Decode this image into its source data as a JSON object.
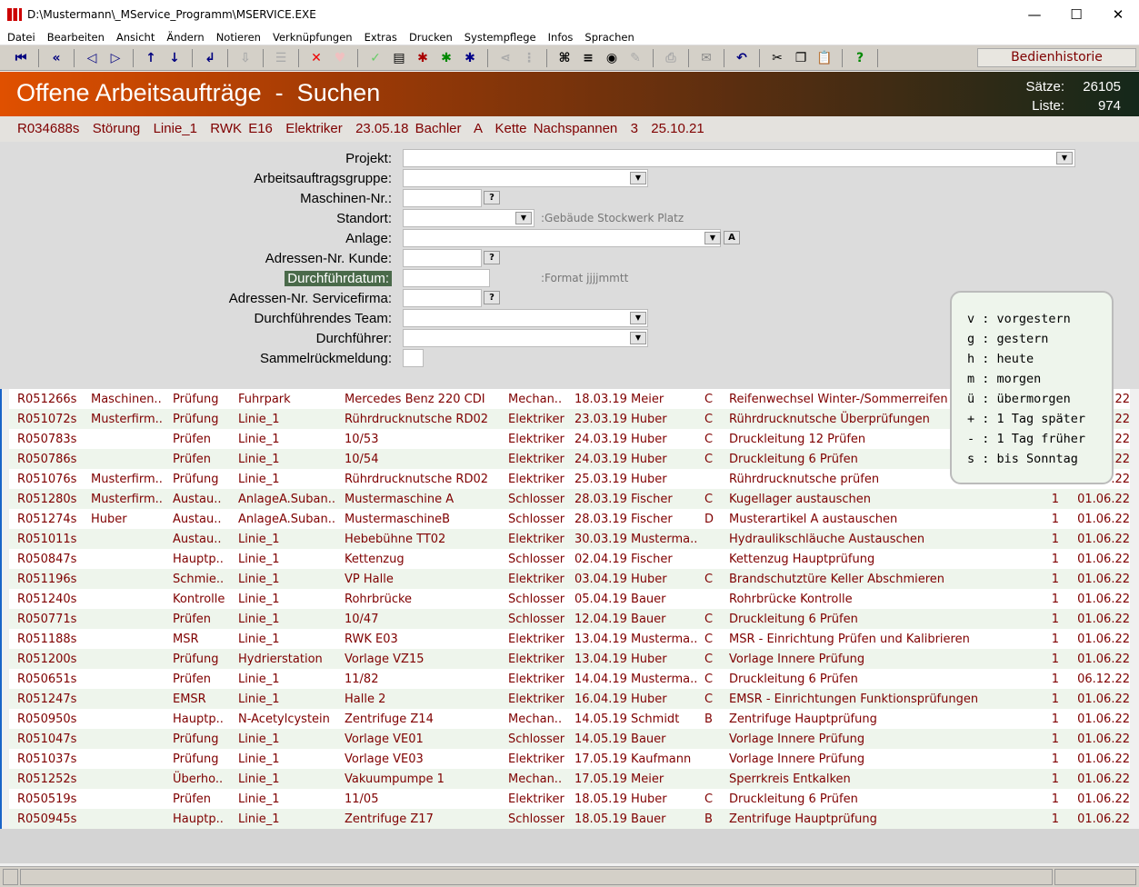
{
  "window": {
    "title": "D:\\Mustermann\\_MService_Programm\\MSERVICE.EXE",
    "min": "—",
    "max": "☐",
    "close": "✕"
  },
  "menu": [
    "Datei",
    "Bearbeiten",
    "Ansicht",
    "Ändern",
    "Notieren",
    "Verknüpfungen",
    "Extras",
    "Drucken",
    "Systempflege",
    "Infos",
    "Sprachen"
  ],
  "toolbar": {
    "history_label": "Bedienhistorie"
  },
  "header": {
    "title": "Offene Arbeitsaufträge  -  Suchen",
    "saetze_label": "Sätze:",
    "saetze": "26105",
    "liste_label": "Liste:",
    "liste": "974"
  },
  "info_line": "R034688s  Störung  Linie_1  RWK E16  Elektriker  23.05.18 Bachler  A  Kette Nachspannen  3  25.10.21",
  "form": {
    "projekt": "Projekt:",
    "gruppe": "Arbeitsauftragsgruppe:",
    "maschine": "Maschinen-Nr.:",
    "standort": "Standort:",
    "standort_hint": ":Gebäude Stockwerk Platz",
    "anlage": "Anlage:",
    "anlage_btn": "A",
    "kunde": "Adressen-Nr. Kunde:",
    "datum": "Durchführdatum:",
    "datum_hint": ":Format jjjjmmtt",
    "servicefirma": "Adressen-Nr. Servicefirma:",
    "team": "Durchführendes Team:",
    "durchfuehrer": "Durchführer:",
    "sammel": "Sammelrückmeldung:",
    "q": "?",
    "dd": "▼"
  },
  "date_help": [
    "v : vorgestern",
    "g : gestern",
    "h : heute",
    "m : morgen",
    "ü : übermorgen",
    "+ : 1 Tag später",
    "- : 1 Tag früher",
    "s : bis Sonntag"
  ],
  "rows": [
    [
      "R051266s",
      "Maschinen..",
      "Prüfung",
      "Fuhrpark",
      "Mercedes Benz 220 CDI",
      "Mechan..",
      "18.03.19 Meier",
      "C",
      "Reifenwechsel Winter-/Sommerreifen",
      "1",
      "01.06.22"
    ],
    [
      "R051072s",
      "Musterfirm..",
      "Prüfung",
      "Linie_1",
      "Rührdrucknutsche RD02",
      "Elektriker",
      "23.03.19 Huber",
      "C",
      "Rührdrucknutsche Überprüfungen",
      "1",
      "01.06.22"
    ],
    [
      "R050783s",
      "",
      "Prüfen",
      "Linie_1",
      "10/53",
      "Elektriker",
      "24.03.19 Huber",
      "C",
      "Druckleitung 12 Prüfen",
      "1",
      "01.06.22"
    ],
    [
      "R050786s",
      "",
      "Prüfen",
      "Linie_1",
      "10/54",
      "Elektriker",
      "24.03.19 Huber",
      "C",
      "Druckleitung 6 Prüfen",
      "1",
      "01.06.22"
    ],
    [
      "R051076s",
      "Musterfirm..",
      "Prüfung",
      "Linie_1",
      "Rührdrucknutsche RD02",
      "Elektriker",
      "25.03.19 Huber",
      "",
      "Rührdrucknutsche prüfen",
      "1",
      "01.06.22"
    ],
    [
      "R051280s",
      "Musterfirm..",
      "Austau..",
      "AnlageA.Suban..",
      "Mustermaschine A",
      "Schlosser",
      "28.03.19 Fischer",
      "C",
      "Kugellager austauschen",
      "1",
      "01.06.22"
    ],
    [
      "R051274s",
      "Huber",
      "Austau..",
      "AnlageA.Suban..",
      "MustermaschineB",
      "Schlosser",
      "28.03.19 Fischer",
      "D",
      "Musterartikel A austauschen",
      "1",
      "01.06.22"
    ],
    [
      "R051011s",
      "",
      "Austau..",
      "Linie_1",
      "Hebebühne TT02",
      "Elektriker",
      "30.03.19 Musterma..",
      "",
      "Hydraulikschläuche Austauschen",
      "1",
      "01.06.22"
    ],
    [
      "R050847s",
      "",
      "Hauptp..",
      "Linie_1",
      "Kettenzug",
      "Schlosser",
      "02.04.19 Fischer",
      "",
      "Kettenzug Hauptprüfung",
      "1",
      "01.06.22"
    ],
    [
      "R051196s",
      "",
      "Schmie..",
      "Linie_1",
      "VP Halle",
      "Elektriker",
      "03.04.19 Huber",
      "C",
      "Brandschutztüre Keller Abschmieren",
      "1",
      "01.06.22"
    ],
    [
      "R051240s",
      "",
      "Kontrolle",
      "Linie_1",
      "Rohrbrücke",
      "Schlosser",
      "05.04.19 Bauer",
      "",
      "Rohrbrücke Kontrolle",
      "1",
      "01.06.22"
    ],
    [
      "R050771s",
      "",
      "Prüfen",
      "Linie_1",
      "10/47",
      "Schlosser",
      "12.04.19 Bauer",
      "C",
      "Druckleitung 6 Prüfen",
      "1",
      "01.06.22"
    ],
    [
      "R051188s",
      "",
      "MSR",
      "Linie_1",
      "RWK E03",
      "Elektriker",
      "13.04.19 Musterma..",
      "C",
      "MSR - Einrichtung Prüfen und Kalibrieren",
      "1",
      "01.06.22"
    ],
    [
      "R051200s",
      "",
      "Prüfung",
      "Hydrierstation",
      "Vorlage VZ15",
      "Elektriker",
      "13.04.19 Huber",
      "C",
      "Vorlage Innere Prüfung",
      "1",
      "01.06.22"
    ],
    [
      "R050651s",
      "",
      "Prüfen",
      "Linie_1",
      "11/82",
      "Elektriker",
      "14.04.19 Musterma..",
      "C",
      "Druckleitung 6 Prüfen",
      "1",
      "06.12.22"
    ],
    [
      "R051247s",
      "",
      "EMSR",
      "Linie_1",
      "Halle 2",
      "Elektriker",
      "16.04.19 Huber",
      "C",
      "EMSR - Einrichtungen Funktionsprüfungen",
      "1",
      "01.06.22"
    ],
    [
      "R050950s",
      "",
      "Hauptp..",
      "N-Acetylcystein",
      "Zentrifuge Z14",
      "Mechan..",
      "14.05.19 Schmidt",
      "B",
      "Zentrifuge Hauptprüfung",
      "1",
      "01.06.22"
    ],
    [
      "R051047s",
      "",
      "Prüfung",
      "Linie_1",
      "Vorlage VE01",
      "Schlosser",
      "14.05.19 Bauer",
      "",
      "Vorlage Innere Prüfung",
      "1",
      "01.06.22"
    ],
    [
      "R051037s",
      "",
      "Prüfung",
      "Linie_1",
      "Vorlage VE03",
      "Elektriker",
      "17.05.19 Kaufmann",
      "",
      "Vorlage Innere Prüfung",
      "1",
      "01.06.22"
    ],
    [
      "R051252s",
      "",
      "Überho..",
      "Linie_1",
      "Vakuumpumpe 1",
      "Mechan..",
      "17.05.19 Meier",
      "",
      "Sperrkreis Entkalken",
      "1",
      "01.06.22"
    ],
    [
      "R050519s",
      "",
      "Prüfen",
      "Linie_1",
      "11/05",
      "Elektriker",
      "18.05.19 Huber",
      "C",
      "Druckleitung 6 Prüfen",
      "1",
      "01.06.22"
    ],
    [
      "R050945s",
      "",
      "Hauptp..",
      "Linie_1",
      "Zentrifuge Z17",
      "Schlosser",
      "18.05.19 Bauer",
      "B",
      "Zentrifuge Hauptprüfung",
      "1",
      "01.06.22"
    ]
  ]
}
